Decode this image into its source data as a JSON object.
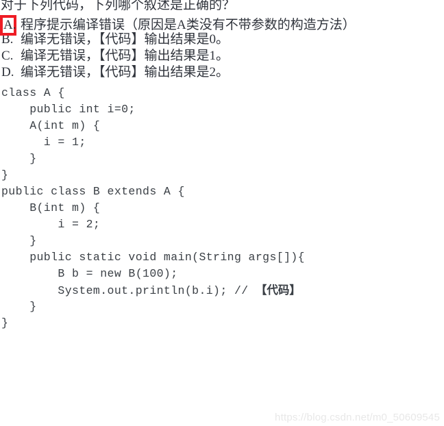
{
  "quiz": {
    "question": "对于下列代码，下列哪个叙述是正确的？",
    "highlight_color": "#ee1c25",
    "text_color": "#30343c",
    "options": [
      {
        "label": "A.",
        "text": "程序提示编译错误（原因是A类没有不带参数的构造方法）",
        "highlighted": true
      },
      {
        "label": "B.",
        "text": "编译无错误，【代码】输出结果是0。",
        "highlighted": false
      },
      {
        "label": "C.",
        "text": "编译无错误，【代码】输出结果是1。",
        "highlighted": false
      },
      {
        "label": "D.",
        "text": "编译无错误，【代码】输出结果是2。",
        "highlighted": false
      }
    ]
  },
  "code": {
    "language": "java",
    "lines": [
      "class A {",
      "    public int i=0;",
      "    A(int m) {",
      "      i = 1;",
      "    }",
      "}",
      "public class B extends A {",
      "    B(int m) {",
      "        i = 2;",
      "    }",
      "    public static void main(String args[]){",
      "        B b = new B(100);",
      "        System.out.println(b.i); // ",
      "    }",
      "}"
    ],
    "code_comment_cjk": "【代码】",
    "code_comment_line_index": 12
  },
  "watermark": {
    "text": "https://blog.csdn.net/m0_50609545",
    "color": "#e8e8e8"
  }
}
